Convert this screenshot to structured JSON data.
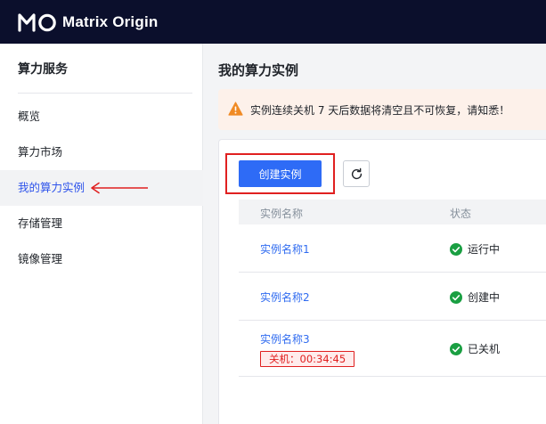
{
  "header": {
    "logo_text": "Matrix Origin",
    "background": "#0b0f2c"
  },
  "sidebar": {
    "title": "算力服务",
    "items": [
      {
        "label": "概览",
        "active": false
      },
      {
        "label": "算力市场",
        "active": false
      },
      {
        "label": "我的算力实例",
        "active": true
      },
      {
        "label": "存储管理",
        "active": false
      },
      {
        "label": "镜像管理",
        "active": false
      }
    ]
  },
  "main": {
    "title": "我的算力实例",
    "alert": {
      "icon": "warning-icon",
      "text": "实例连续关机 7 天后数据将清空且不可恢复，请知悉！",
      "color": "#f08a24"
    },
    "toolbar": {
      "create_label": "创建实例",
      "refresh_icon": "refresh-icon"
    },
    "table": {
      "columns": [
        "实例名称",
        "状态"
      ],
      "rows": [
        {
          "name": "实例名称1",
          "status": "运行中",
          "tag": null
        },
        {
          "name": "实例名称2",
          "status": "创建中",
          "tag": null
        },
        {
          "name": "实例名称3",
          "status": "已关机",
          "tag": "关机：00:34:45"
        }
      ]
    }
  },
  "colors": {
    "accent": "#2e6bf6",
    "highlight": "#e02020",
    "success": "#1a9f42"
  }
}
